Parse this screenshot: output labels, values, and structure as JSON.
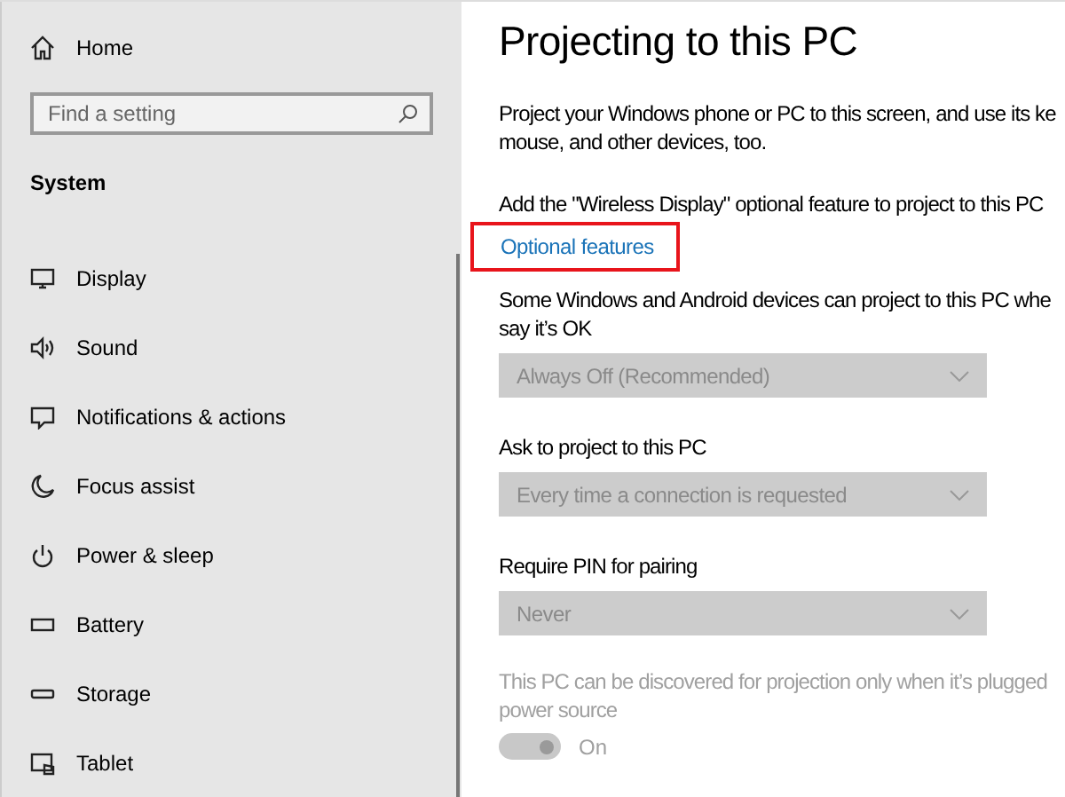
{
  "sidebar": {
    "home": "Home",
    "search": {
      "placeholder": "Find a setting"
    },
    "section": "System",
    "items": [
      {
        "label": "Display"
      },
      {
        "label": "Sound"
      },
      {
        "label": "Notifications & actions"
      },
      {
        "label": "Focus assist"
      },
      {
        "label": "Power & sleep"
      },
      {
        "label": "Battery"
      },
      {
        "label": "Storage"
      },
      {
        "label": "Tablet"
      }
    ]
  },
  "content": {
    "title": "Projecting to this PC",
    "intro": [
      "Project your Windows phone or PC to this screen, and use its ke",
      "mouse, and other devices, too."
    ],
    "feature_text": "Add the \"Wireless Display\" optional feature to project to this PC",
    "link": {
      "label": "Optional features",
      "highlighted": true
    },
    "settings": [
      {
        "label": [
          "Some Windows and Android devices can project to this PC whe",
          "say it’s OK"
        ],
        "value": "Always Off (Recommended)",
        "disabled": true
      },
      {
        "label": [
          "Ask to project to this PC"
        ],
        "value": "Every time a connection is requested",
        "disabled": true
      },
      {
        "label": [
          "Require PIN for pairing"
        ],
        "value": "Never",
        "disabled": true
      }
    ],
    "power_note": [
      "This PC can be discovered for projection only when it’s plugged",
      "power source"
    ],
    "toggle": {
      "on": true,
      "disabled": true,
      "label": "On"
    }
  }
}
